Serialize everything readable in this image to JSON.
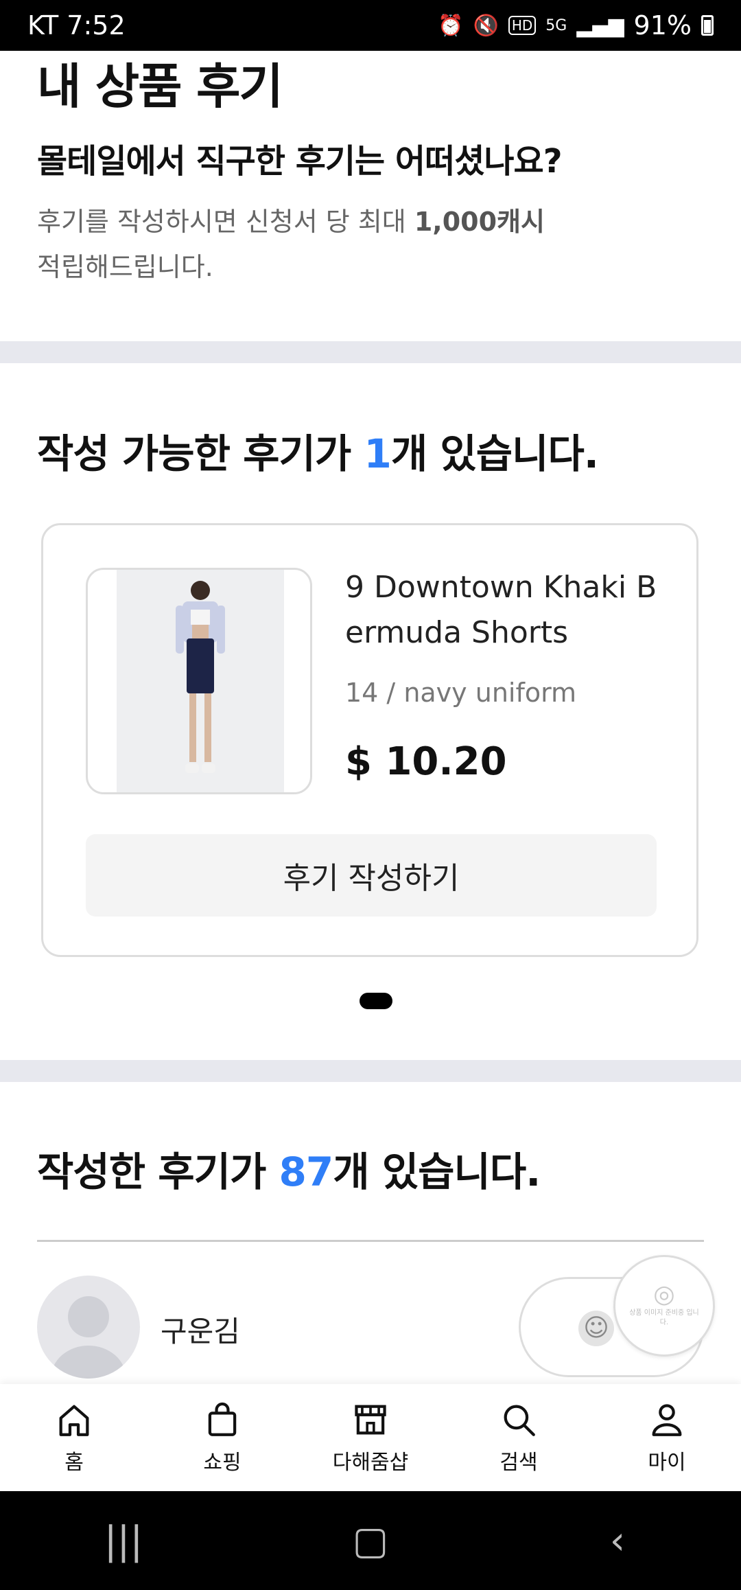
{
  "status": {
    "carrier": "KT",
    "time": "7:52",
    "battery": "91%",
    "icons": [
      "alarm-icon",
      "mute-icon",
      "hd-icon",
      "5g-icon",
      "signal-icon",
      "battery-icon"
    ]
  },
  "header": {
    "title": "내 상품 후기",
    "subtitle": "몰테일에서 직구한 후기는 어떠셨나요?",
    "desc_part1": "후기를 작성하시면 신청서 당 최대 ",
    "desc_bold": "1,000캐시",
    "desc_part2": "적립해드립니다."
  },
  "writable": {
    "heading_prefix": "작성 가능한 후기가 ",
    "count": "1",
    "heading_suffix": "개 있습니다.",
    "item": {
      "name": "9 Downtown Khaki Bermuda Shorts",
      "option": "14 / navy uniform",
      "price": "$ 10.20",
      "button": "후기 작성하기"
    }
  },
  "written": {
    "heading_prefix": "작성한 후기가 ",
    "count": "87",
    "heading_suffix": "개 있습니다.",
    "review": {
      "user": "구운김"
    },
    "badge_caption": "상품 이미지 준비중 입니다."
  },
  "bottom_nav": [
    {
      "label": "홈",
      "icon": "home-icon"
    },
    {
      "label": "쇼핑",
      "icon": "shopping-bag-icon"
    },
    {
      "label": "다해줌샵",
      "icon": "store-icon"
    },
    {
      "label": "검색",
      "icon": "search-icon"
    },
    {
      "label": "마이",
      "icon": "user-icon"
    }
  ],
  "colors": {
    "accent": "#2f7ef7",
    "divider": "#e7e8ee"
  }
}
